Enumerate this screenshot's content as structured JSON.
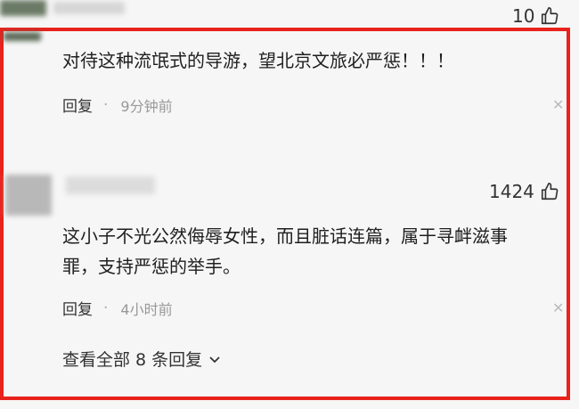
{
  "comment0": {
    "likes": "10"
  },
  "comment1": {
    "text": "对待这种流氓式的导游，望北京文旅必严惩！！！",
    "reply_label": "回复",
    "separator": "·",
    "time": "9分钟前"
  },
  "comment2": {
    "likes": "1424",
    "text_line1": "这小子不光公然侮辱女性，而且脏话连篇，属于寻衅滋事",
    "text_line2": "罪，支持严惩的举手。",
    "reply_label": "回复",
    "separator": "·",
    "time": "4小时前"
  },
  "view_all": {
    "label": "查看全部 8 条回复"
  },
  "icons": {
    "like": "thumbs-up-icon",
    "close": "close-icon",
    "expand": "chevron-down-icon"
  },
  "colors": {
    "highlight_border": "#e8221c"
  }
}
